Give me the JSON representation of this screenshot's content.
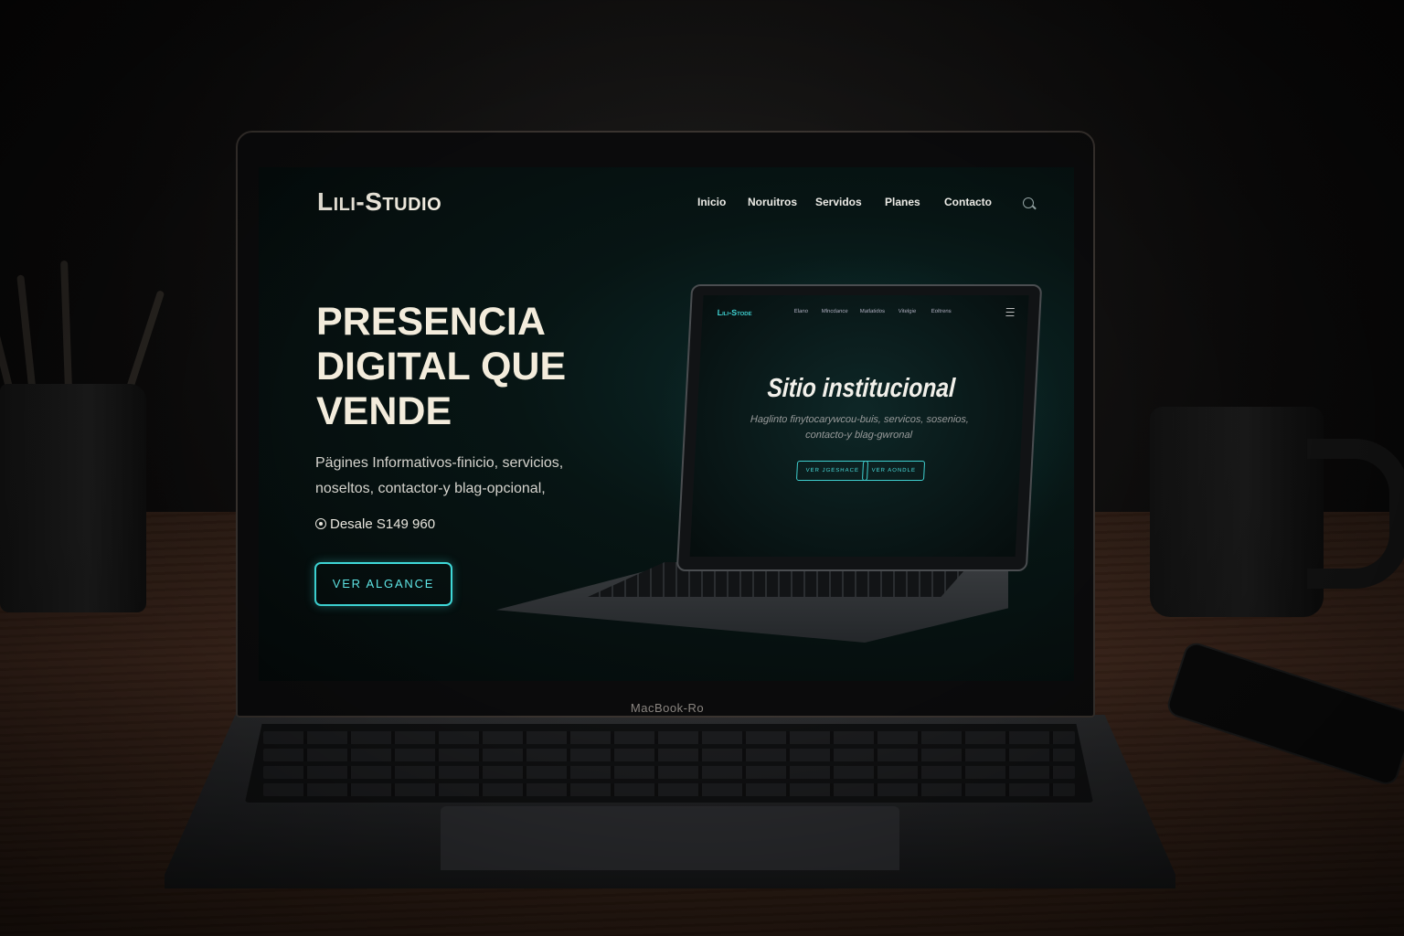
{
  "site": {
    "logo": "Lili-Studio",
    "nav": [
      {
        "label": "Inicio"
      },
      {
        "label": "Noruitros"
      },
      {
        "label": "Servidos"
      },
      {
        "label": "Planes"
      },
      {
        "label": "Contacto"
      }
    ],
    "hero": {
      "title": "PRESENCIA DIGITAL QUE VENDE",
      "subtitle": "Pägines Informativos-finicio, servicios, noseltos, contactor-y blag-opcional,",
      "price": "Desale S149 960",
      "cta_label": "VER ALGANCE"
    }
  },
  "mockup": {
    "logo": "Lili-Stode",
    "nav": [
      "Elano",
      "Mlncdance",
      "Matlatidos",
      "Vitelgie",
      "Eoltrens"
    ],
    "title": "Sitio institucional",
    "subtitle": "Haglinto finytocarywcou-buis, servicos, sosenios, contacto-y blag-gwronal",
    "buttons": [
      "VER JGESHACE",
      "VER AONDLE"
    ]
  },
  "device": {
    "label": "MacBook-Ro"
  },
  "colors": {
    "accent": "#3fd9d9",
    "background": "#040909",
    "text": "#f3ecdc"
  },
  "icons": [
    "search-icon",
    "price-icon",
    "menu-icon"
  ]
}
